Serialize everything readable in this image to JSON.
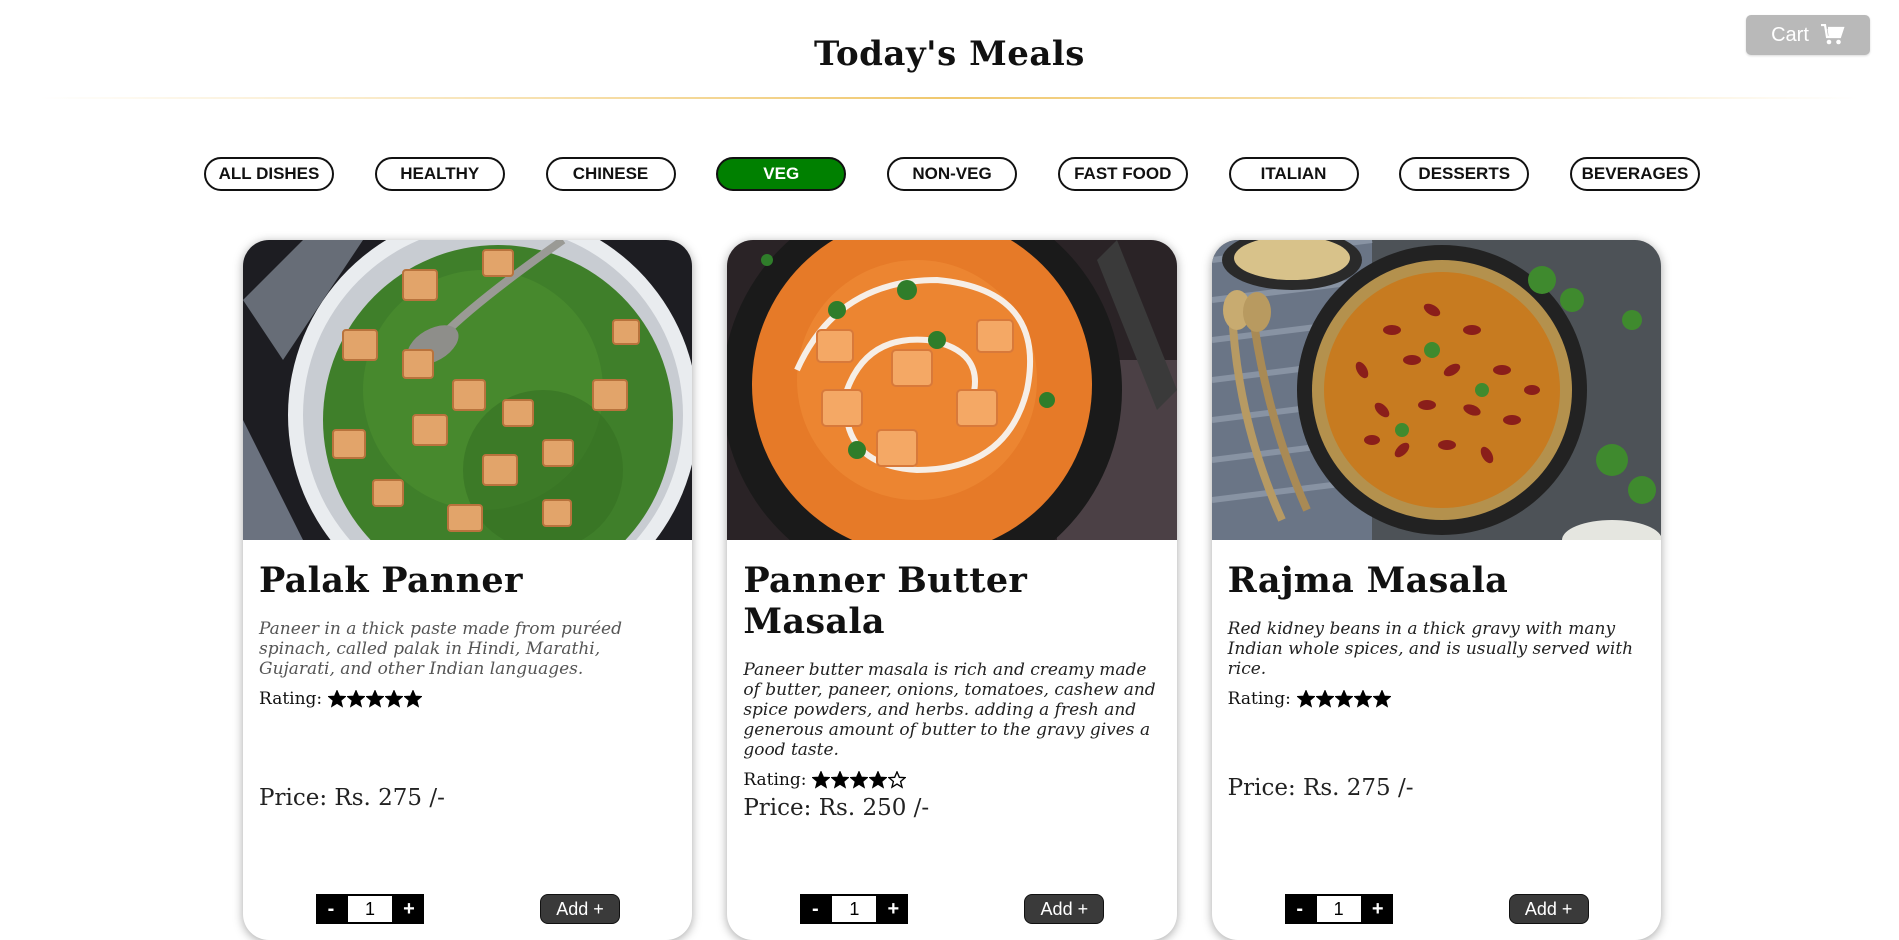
{
  "header": {
    "title": "Today's Meals",
    "cart_label": "Cart"
  },
  "filters": [
    {
      "label": "ALL DISHES",
      "active": false
    },
    {
      "label": "HEALTHY",
      "active": false
    },
    {
      "label": "CHINESE",
      "active": false
    },
    {
      "label": "VEG",
      "active": true
    },
    {
      "label": "NON-VEG",
      "active": false
    },
    {
      "label": "FAST FOOD",
      "active": false
    },
    {
      "label": "ITALIAN",
      "active": false
    },
    {
      "label": "DESSERTS",
      "active": false
    },
    {
      "label": "BEVERAGES",
      "active": false
    }
  ],
  "colors": {
    "active_filter": "#008000",
    "cart_button": "#b9b9b9",
    "title_rule": "#f0c86e",
    "add_button": "#3a3a3a"
  },
  "rating_label": "Rating:",
  "dishes": [
    {
      "name": "Palak Panner",
      "description": "Paneer in a thick paste made from puréed spinach, called palak in Hindi, Marathi, Gujarati, and other Indian languages.",
      "rating": 5,
      "rating_max": 5,
      "price": "Price: Rs. 275 /-",
      "quantity": "1",
      "add_label": "Add +",
      "image_icon": "palak-paneer-photo"
    },
    {
      "name": "Panner Butter Masala",
      "description": "Paneer butter masala is rich and creamy made of butter, paneer, onions, tomatoes, cashew and spice powders, and herbs. adding a fresh and generous amount of butter to the gravy gives a good taste.",
      "rating": 4,
      "rating_max": 5,
      "price": "Price: Rs. 250 /-",
      "quantity": "1",
      "add_label": "Add +",
      "image_icon": "paneer-butter-masala-photo"
    },
    {
      "name": "Rajma Masala",
      "description": "Red kidney beans in a thick gravy with many Indian whole spices, and is usually served with rice.",
      "rating": 5,
      "rating_max": 5,
      "price": "Price: Rs. 275 /-",
      "quantity": "1",
      "add_label": "Add +",
      "image_icon": "rajma-masala-photo"
    }
  ],
  "qty_minus": "-",
  "qty_plus": "+"
}
